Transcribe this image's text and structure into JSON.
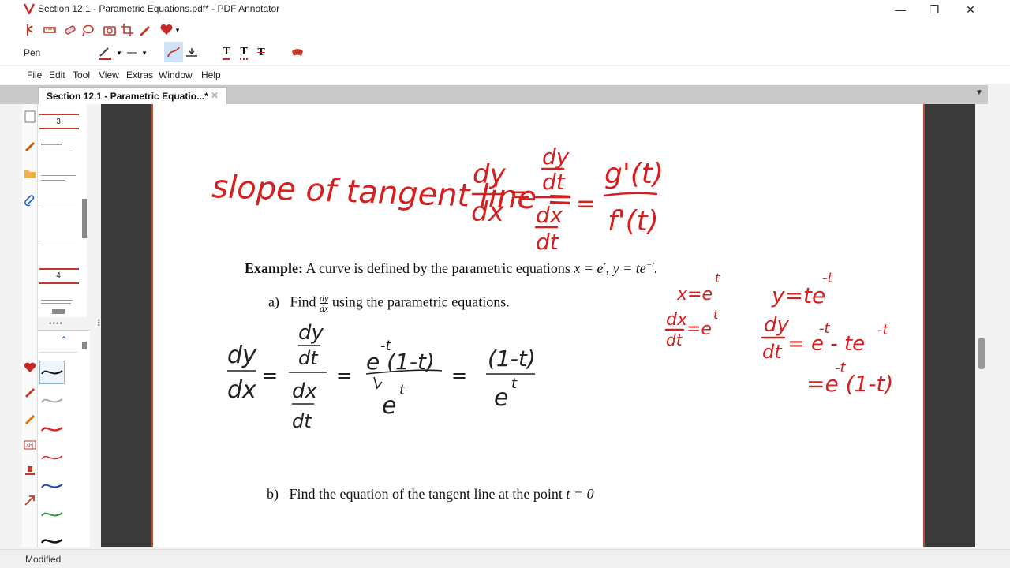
{
  "window": {
    "title": "Section 12.1 - Parametric Equations.pdf* - PDF Annotator",
    "minimize": "—",
    "maximize": "❐",
    "close": "✕"
  },
  "toolbar": {
    "tool_label": "Pen",
    "icons": [
      "select-icon",
      "ruler-icon",
      "eraser-icon",
      "lasso-icon",
      "camera-icon",
      "crop-icon",
      "highlighter-icon",
      "favorites-icon"
    ]
  },
  "menu": [
    "File",
    "Edit",
    "Tool",
    "View",
    "Extras",
    "Window",
    "Help"
  ],
  "tab": {
    "label": "Section 12.1 - Parametric Equatio...*",
    "close": "✕"
  },
  "thumbnails": {
    "pages": [
      "3",
      "4"
    ]
  },
  "pens": {
    "colors": [
      "#111111",
      "#aaaaaa",
      "#d62828",
      "#d62828",
      "#1f3fb8",
      "#2a9a3a",
      "#111111"
    ]
  },
  "page": {
    "example_label": "Example:",
    "example_text": "A curve is defined by the parametric equations",
    "example_math": "x = e",
    "part_a_label": "a)",
    "part_a_text": "Find",
    "part_a_tail": "using the parametric equations.",
    "part_b_label": "b)",
    "part_b_text": "Find the equation of the tangent line at the point",
    "part_b_math": "t = 0"
  },
  "handwriting": {
    "line1": "slope of tangent line = dy/dx = (dy/dt)/(dx/dt) = g'(t)/f'(t)",
    "line2": "dy/dx = (dy/dt)/(dx/dt) = e^-t(1-t)/e^t = (1-t)/e^t",
    "side1": "x = e^t",
    "side2": "dx/dt = e^t",
    "side3": "y = te^-t",
    "side4": "dy/dt = e^-t - te^-t",
    "side5": "= e^-t(1-t)"
  },
  "status": {
    "text": "Modified"
  }
}
